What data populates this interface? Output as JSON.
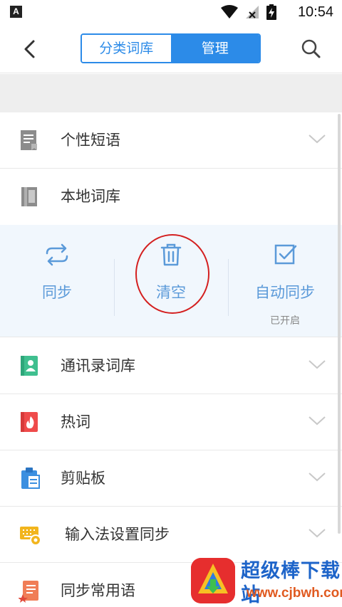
{
  "status_bar": {
    "badge": "A",
    "time": "10:54",
    "icons": [
      "wifi-icon",
      "no-signal-icon",
      "battery-charging-icon"
    ]
  },
  "nav": {
    "tabs": [
      {
        "label": "分类词库",
        "active": false
      },
      {
        "label": "管理",
        "active": true
      }
    ],
    "accent_color": "#2c8be8"
  },
  "rows": [
    {
      "label": "个性短语",
      "icon": "phrase-doc-icon"
    },
    {
      "label": "本地词库",
      "icon": "local-book-icon"
    },
    {
      "label": "通讯录词库",
      "icon": "contacts-book-icon"
    },
    {
      "label": "热词",
      "icon": "hot-word-icon"
    },
    {
      "label": "剪贴板",
      "icon": "clipboard-icon"
    },
    {
      "label": "输入法设置同步",
      "icon": "keyboard-sync-icon"
    },
    {
      "label": "同步常用语",
      "icon": "common-phrase-icon"
    }
  ],
  "local_actions": [
    {
      "label": "同步",
      "icon": "sync-icon"
    },
    {
      "label": "清空",
      "icon": "trash-icon"
    },
    {
      "label": "自动同步",
      "sublabel": "已开启",
      "icon": "checkbox-checked-icon"
    }
  ],
  "watermark": {
    "title": "超级棒下载站",
    "url": "www.cjbwh.com"
  }
}
